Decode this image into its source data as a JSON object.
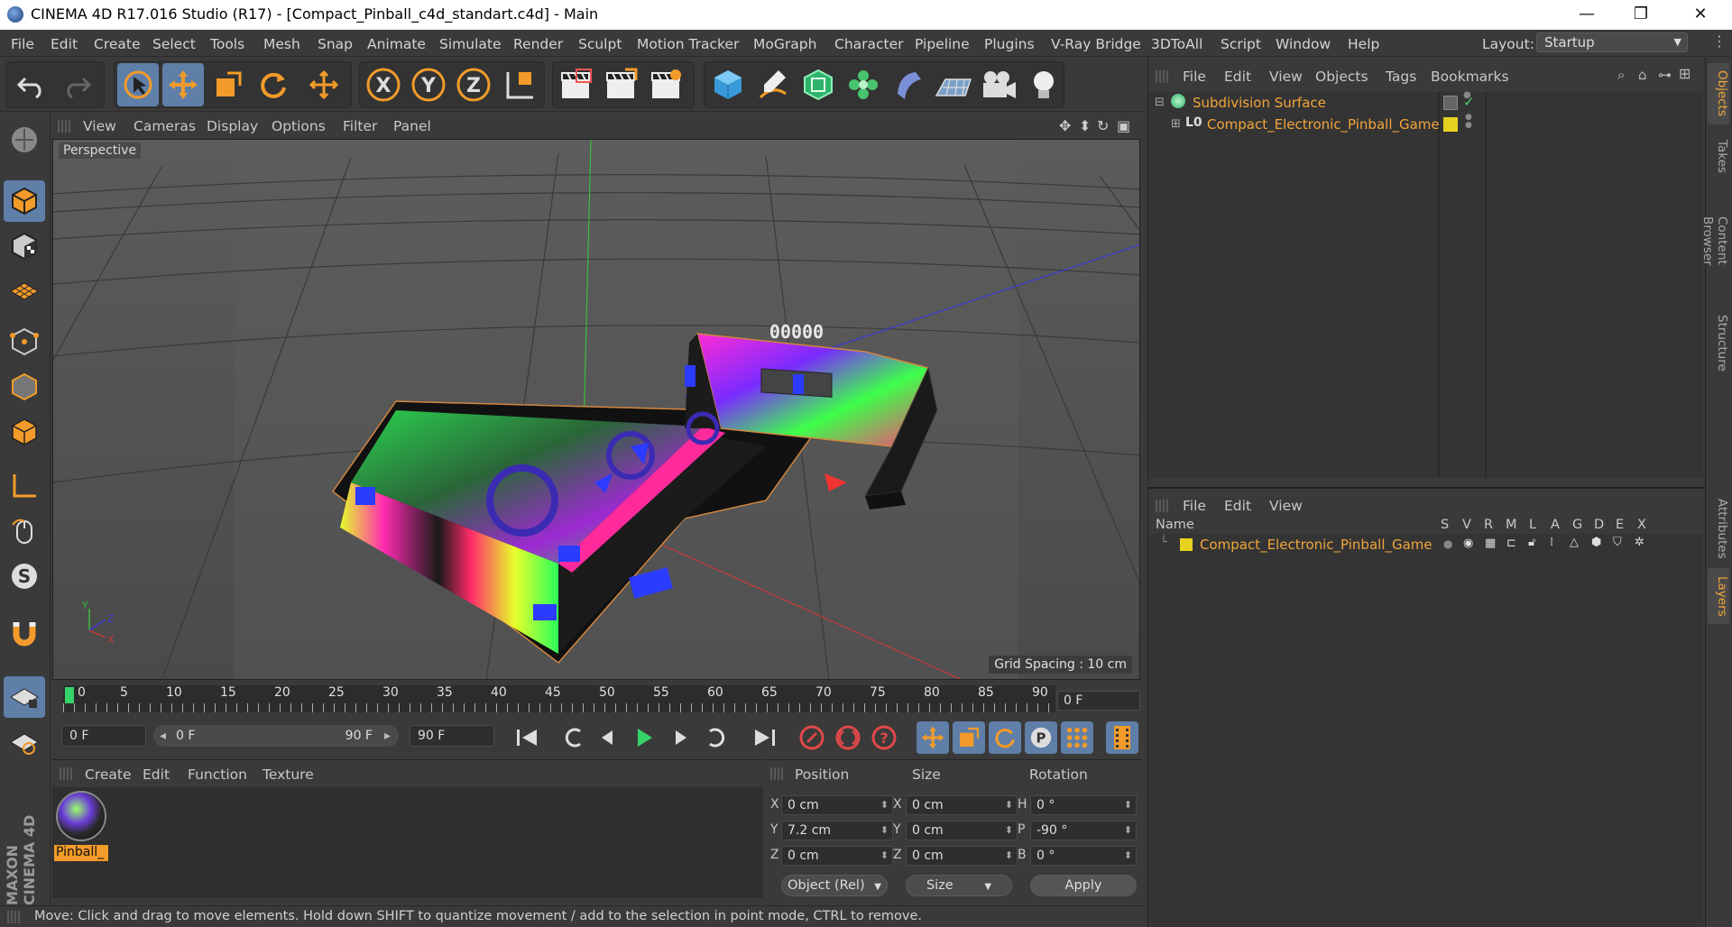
{
  "window": {
    "title": "CINEMA 4D R17.016 Studio (R17) - [Compact_Pinball_c4d_standart.c4d] - Main",
    "minimize": "—",
    "maximize": "❐",
    "close": "✕"
  },
  "menu": [
    "File",
    "Edit",
    "Create",
    "Select",
    "Tools",
    "Mesh",
    "Snap",
    "Animate",
    "Simulate",
    "Render",
    "Sculpt",
    "Motion Tracker",
    "MoGraph",
    "Character",
    "Pipeline",
    "Plugins",
    "V-Ray Bridge",
    "3DToAll",
    "Script",
    "Window",
    "Help"
  ],
  "layout": {
    "label": "Layout:",
    "value": "Startup"
  },
  "viewport": {
    "menu": [
      "View",
      "Cameras",
      "Display",
      "Options",
      "Filter",
      "Panel"
    ],
    "label": "Perspective",
    "grid_spacing": "Grid Spacing : 10 cm",
    "score_display": "00000",
    "axis_y": "Y",
    "axis_z": "Z",
    "axis_x": "X"
  },
  "timeline": {
    "ticks": [
      "0",
      "5",
      "10",
      "15",
      "20",
      "25",
      "30",
      "35",
      "40",
      "45",
      "50",
      "55",
      "60",
      "65",
      "70",
      "75",
      "80",
      "85",
      "90"
    ],
    "current_frame": "0 F",
    "start_field": "0 F",
    "range_start": "0 F",
    "range_end": "90 F",
    "end_field": "90 F"
  },
  "materials": {
    "menu": [
      "Create",
      "Edit",
      "Function",
      "Texture"
    ],
    "items": [
      {
        "name": "Pinball_"
      }
    ]
  },
  "coordinates": {
    "headers": {
      "position": "Position",
      "size": "Size",
      "rotation": "Rotation"
    },
    "rows": [
      {
        "pos_axis": "X",
        "pos": "0 cm",
        "size_axis": "X",
        "size": "0 cm",
        "rot_axis": "H",
        "rot": "0 °"
      },
      {
        "pos_axis": "Y",
        "pos": "7.2 cm",
        "size_axis": "Y",
        "size": "0 cm",
        "rot_axis": "P",
        "rot": "-90 °"
      },
      {
        "pos_axis": "Z",
        "pos": "0 cm",
        "size_axis": "Z",
        "size": "0 cm",
        "rot_axis": "B",
        "rot": "0 °"
      }
    ],
    "mode_dropdown": "Object (Rel)",
    "size_dropdown": "Size",
    "apply": "Apply"
  },
  "status": "Move: Click and drag to move elements. Hold down SHIFT to quantize movement / add to the selection in point mode, CTRL to remove.",
  "objects_panel": {
    "menu": [
      "File",
      "Edit",
      "View",
      "Objects",
      "Tags",
      "Bookmarks"
    ],
    "rows": [
      {
        "name": "Subdivision Surface"
      },
      {
        "name": "Compact_Electronic_Pinball_Game"
      }
    ]
  },
  "layers_panel": {
    "menu": [
      "File",
      "Edit",
      "View"
    ],
    "columns": [
      "Name",
      "S",
      "V",
      "R",
      "M",
      "L",
      "A",
      "G",
      "D",
      "E",
      "X"
    ],
    "rows": [
      {
        "name": "Compact_Electronic_Pinball_Game"
      }
    ]
  },
  "right_tabs": [
    "Objects",
    "Takes",
    "Content Browser",
    "Structure",
    "Attributes",
    "Layers"
  ],
  "branding": "MAXON CINEMA 4D",
  "colors": {
    "accent_orange": "#f2a53a",
    "active_blue": "#5f7fa8",
    "layer_yellow": "#e6d21e"
  }
}
